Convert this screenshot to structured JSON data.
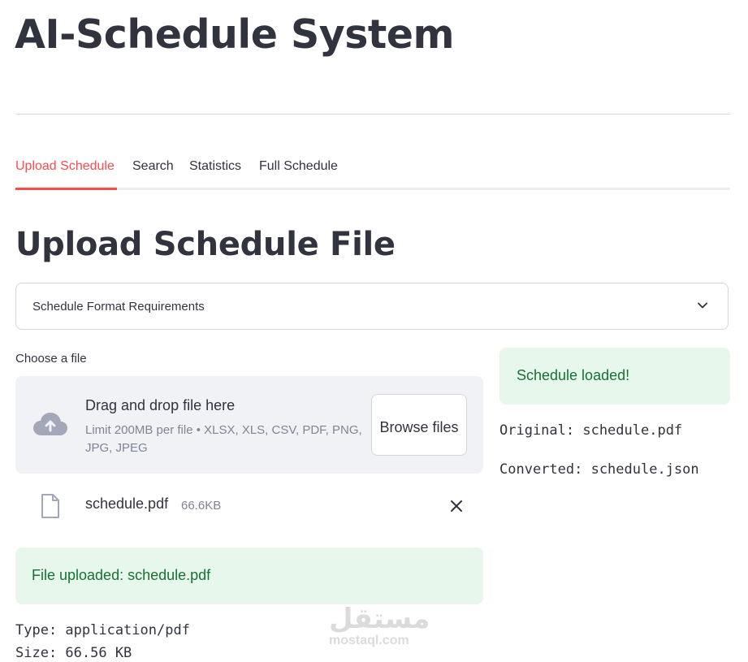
{
  "app": {
    "title": "AI-Schedule System"
  },
  "tabs": [
    {
      "label": "Upload Schedule",
      "active": true
    },
    {
      "label": "Search",
      "active": false
    },
    {
      "label": "Statistics",
      "active": false
    },
    {
      "label": "Full Schedule",
      "active": false
    }
  ],
  "main": {
    "heading": "Upload Schedule File",
    "expander_label": "Schedule Format Requirements",
    "expander_icon": "chevron-down-icon",
    "uploader": {
      "label": "Choose a file",
      "dropzone_title": "Drag and drop file here",
      "dropzone_limit": "Limit 200MB per file • XLSX, XLS, CSV, PDF, PNG, JPG, JPEG",
      "browse_label": "Browse files",
      "upload_icon": "cloud-upload-icon"
    },
    "uploaded_file": {
      "name": "schedule.pdf",
      "size": "66.6KB",
      "file_icon": "file-icon",
      "remove_icon": "close-icon"
    },
    "success_message": "File uploaded: schedule.pdf",
    "file_type": "Type: application/pdf",
    "file_size": "Size: 66.56 KB"
  },
  "side": {
    "success_message": "Schedule loaded!",
    "original": "Original: schedule.pdf",
    "converted": "Converted: schedule.json"
  },
  "watermark": {
    "arabic": "مستقل",
    "latin": "mostaql.com"
  },
  "colors": {
    "accent": "#ff4b4b",
    "success_bg": "#e8f7ec",
    "success_text": "#177233",
    "dropzone_bg": "#f0f2f6",
    "text": "#31333f"
  }
}
